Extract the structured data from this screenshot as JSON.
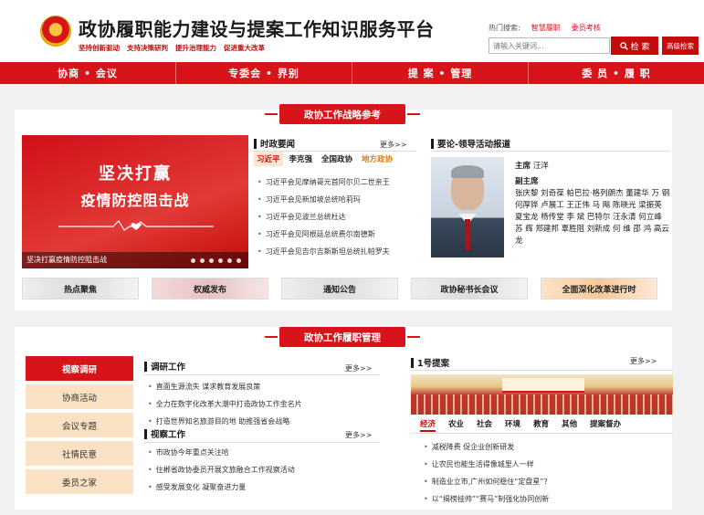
{
  "header": {
    "title": "政协履职能力建设与提案工作知识服务平台",
    "slogans": [
      "坚持创新驱动",
      "支持决策研判",
      "提升治理能力",
      "促进重大改革"
    ],
    "hot_search_label": "热门搜索:",
    "hot_keywords": [
      "智慧履职",
      "委员考核"
    ],
    "search_placeholder": "请输入关键词...",
    "search_button": "检 索",
    "advanced_button": "高级检索"
  },
  "nav": [
    "协商 • 会议",
    "专委会 • 界别",
    "提 案 • 管理",
    "委 员 • 履 职"
  ],
  "panel1": {
    "ribbon": "政协工作战略参考",
    "banner": {
      "line1": "坚决打赢",
      "line2": "疫情防控阻击战",
      "caption": "坚决打赢疫情防控阻击战"
    },
    "news": {
      "title": "时政要闻",
      "more": "更多>>",
      "tabs": [
        "习近平",
        "李克强",
        "全国政协",
        "地方政协"
      ],
      "items": [
        "习近平会见摩纳哥元首阿尔贝二世亲王",
        "习近平会见新加坡总统哈莉玛",
        "习近平会见波兰总统杜达",
        "习近平会见阿根廷总统费尔南德斯",
        "习近平会见吉尔吉斯斯坦总统扎帕罗夫"
      ]
    },
    "leaders": {
      "title": "要论-领导活动报道",
      "chair_label": "主席",
      "chair": "汪洋",
      "vice_label": "副主席",
      "vice_names": "张庆黎 刘奇葆 帕巴拉·格列朗杰 董建华 万 钢 何厚铧 卢展工 王正伟 马 飚 陈晓光 梁振英 夏宝龙 杨传堂 李 斌 巴特尔 汪永清 何立峰 苏 辉 郑建邦 辜胜阻 刘新成 何 维 邵 鸿 高云龙"
    },
    "tiles": [
      "热点聚焦",
      "权威发布",
      "通知公告",
      "政协秘书长会议",
      "全面深化改革进行时"
    ]
  },
  "panel2": {
    "ribbon": "政协工作履职管理",
    "side_menu": [
      "视察调研",
      "协商活动",
      "会议专题",
      "社情民意",
      "委员之家"
    ],
    "research": {
      "title": "调研工作",
      "more": "更多>>",
      "items": [
        "直面生源流失 谋求教育发展良策",
        "全力在数字化改革大潮中打造政协工作金名片",
        "打造世界知名旅游目的地 助推强省会战略"
      ]
    },
    "inspection": {
      "title": "视察工作",
      "more": "更多>>",
      "items": [
        "市政协今年重点关注哈",
        "住郴省政协委员开展文旅融合工作视察活动",
        "感受发展变化 凝聚奋进力量"
      ]
    },
    "proposal": {
      "title": "1号提案",
      "more": "更多>>",
      "tabs": [
        "经济",
        "农业",
        "社会",
        "环境",
        "教育",
        "其他",
        "提案督办"
      ],
      "items": [
        "减税降费 促企业创新研发",
        "让农民也能生活得像城里人一样",
        "制造业立市,广州如何稳住“定盘星”?",
        "以“揭榜挂帅”“赛马”制强化协同创新"
      ]
    }
  },
  "colors": {
    "brand_red": "#d8141b",
    "tab_beige": "#fbe2c4",
    "orange": "#e07a00"
  }
}
